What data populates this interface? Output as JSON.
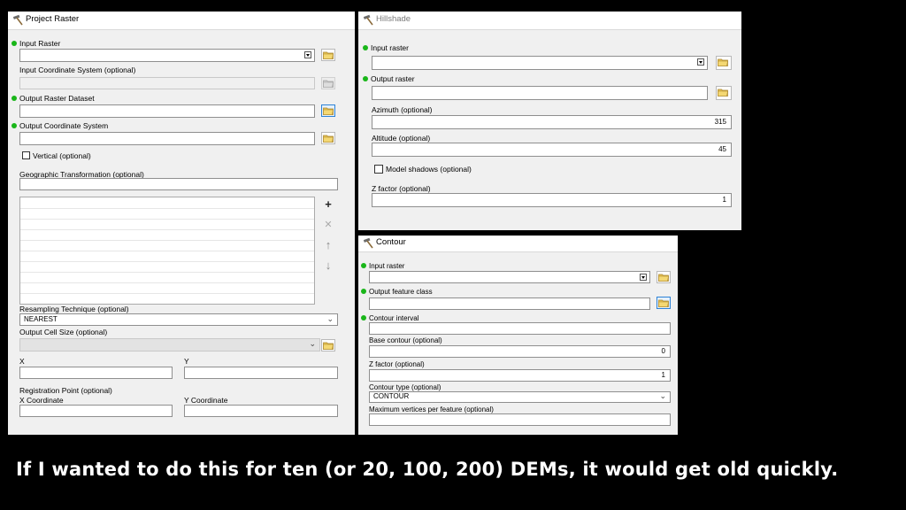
{
  "project_raster": {
    "title": "Project Raster",
    "input_raster_label": "Input Raster",
    "input_raster_value": "",
    "input_coord_label": "Input Coordinate System (optional)",
    "output_raster_label": "Output Raster Dataset",
    "output_raster_value": "",
    "output_coord_label": "Output Coordinate System",
    "output_coord_value": "",
    "vertical_label": "Vertical (optional)",
    "geo_transform_label": "Geographic Transformation (optional)",
    "resampling_label": "Resampling Technique (optional)",
    "resampling_value": "NEAREST",
    "cell_size_label": "Output Cell Size (optional)",
    "x_label": "X",
    "y_label": "Y",
    "registration_label": "Registration Point (optional)",
    "x_coord_label": "X Coordinate",
    "y_coord_label": "Y Coordinate"
  },
  "hillshade": {
    "title": "Hillshade",
    "input_raster_label": "Input raster",
    "output_raster_label": "Output raster",
    "azimuth_label": "Azimuth (optional)",
    "azimuth_value": "315",
    "altitude_label": "Altitude (optional)",
    "altitude_value": "45",
    "model_shadows_label": "Model shadows (optional)",
    "z_factor_label": "Z factor (optional)",
    "z_factor_value": "1"
  },
  "contour": {
    "title": "Contour",
    "input_raster_label": "Input raster",
    "output_feature_label": "Output feature class",
    "contour_interval_label": "Contour interval",
    "base_contour_label": "Base contour (optional)",
    "base_contour_value": "0",
    "z_factor_label": "Z factor (optional)",
    "z_factor_value": "1",
    "contour_type_label": "Contour type (optional)",
    "contour_type_value": "CONTOUR",
    "max_vertices_label": "Maximum vertices per feature (optional)"
  },
  "caption": "If I wanted to do this for ten (or 20, 100, 200) DEMs, it would get old quickly.",
  "colors": {
    "required_dot": "#19b619",
    "background": "#000000",
    "panel": "#f0f0f0",
    "caption": "#ffffff"
  },
  "icons": [
    "hammer-icon",
    "folder-icon",
    "coordinate-system-icon",
    "plus-icon",
    "x-icon",
    "arrow-up-icon",
    "arrow-down-icon",
    "chevron-down-icon"
  ]
}
